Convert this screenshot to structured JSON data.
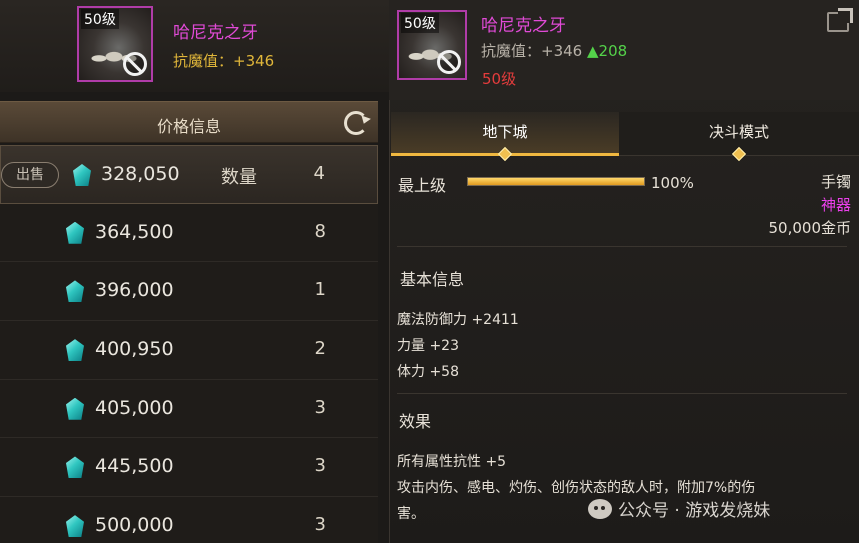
{
  "left_item": {
    "level": "50级",
    "name": "哈尼克之牙",
    "stat": "抗魔值：+346"
  },
  "price_panel": {
    "title": "价格信息",
    "sell_label": "出售",
    "qty_label": "数量",
    "rows": [
      {
        "price": "328,050",
        "qty": "4"
      },
      {
        "price": "364,500",
        "qty": "8"
      },
      {
        "price": "396,000",
        "qty": "1"
      },
      {
        "price": "400,950",
        "qty": "2"
      },
      {
        "price": "405,000",
        "qty": "3"
      },
      {
        "price": "445,500",
        "qty": "3"
      },
      {
        "price": "500,000",
        "qty": "3"
      }
    ]
  },
  "detail": {
    "level": "50级",
    "name": "哈尼克之牙",
    "stat_label": "抗魔值：+346",
    "stat_up": "▲208",
    "level_req": "50级",
    "tabs": [
      "地下城",
      "决斗模式"
    ],
    "grade_label": "最上级",
    "grade_percent": "100%",
    "grade_fill": 1.0,
    "item_type": "手镯",
    "rarity": "神器",
    "value": "50,000金币",
    "basic_info_title": "基本信息",
    "basic_stats": [
      "魔法防御力 +2411",
      "力量 +23",
      "体力 +58"
    ],
    "effect_title": "效果",
    "effect_lines": [
      "所有属性抗性 +5",
      "攻击内伤、感电、灼伤、创伤状态的敌人时，附加7%的伤",
      "害。"
    ]
  },
  "watermark": "公众号 · 游戏发烧妹",
  "colors": {
    "rarity_magenta": "#e04ad6",
    "stat_gold": "#e0b63a",
    "up_green": "#54d24a",
    "level_red": "#e43c3c",
    "tab_gold": "#f0b840"
  }
}
